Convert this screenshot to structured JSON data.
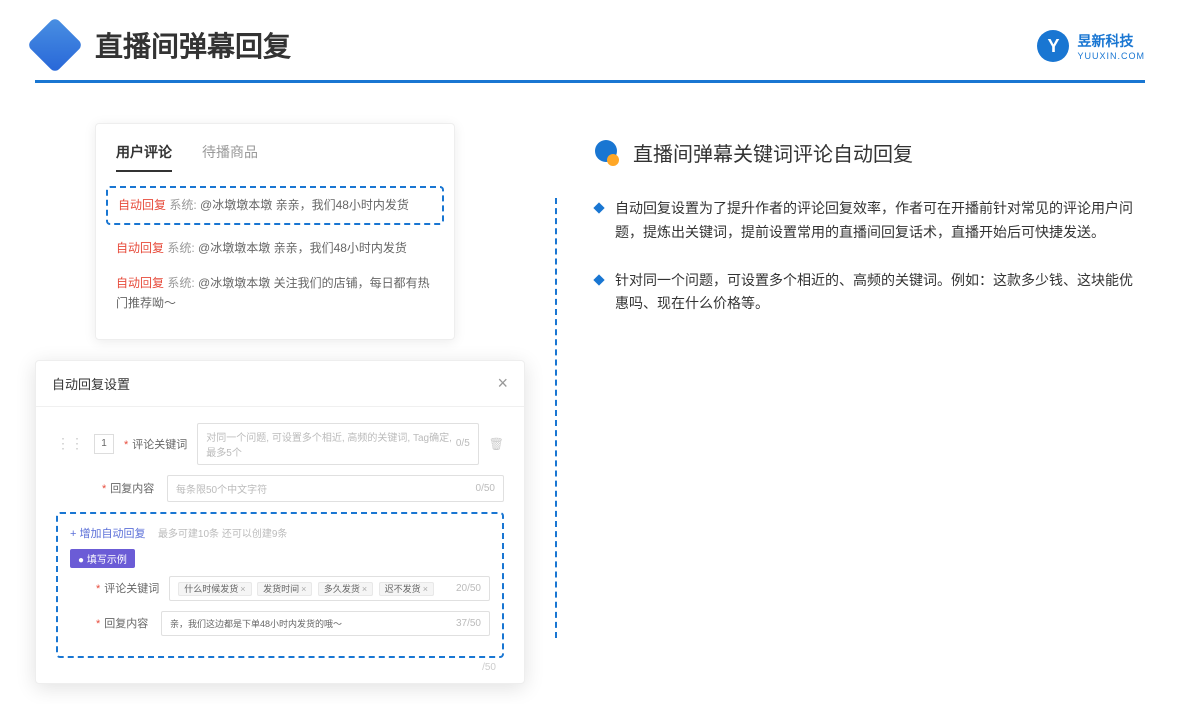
{
  "header": {
    "title": "直播间弹幕回复"
  },
  "brand": {
    "cn": "昱新科技",
    "en": "YUUXIN.COM"
  },
  "comments": {
    "tab1": "用户评论",
    "tab2": "待播商品",
    "autoLabel": "自动回复",
    "sysLabel": "系统:",
    "item1": "@冰墩墩本墩 亲亲，我们48小时内发货",
    "item2": "@冰墩墩本墩 亲亲，我们48小时内发货",
    "item3": "@冰墩墩本墩 关注我们的店铺，每日都有热门推荐呦～"
  },
  "modal": {
    "title": "自动回复设置",
    "rowNum": "1",
    "keywordLabel": "评论关键词",
    "keywordPlaceholder": "对同一个问题, 可设置多个相近, 高频的关键词, Tag确定, 最多5个",
    "keywordCounter": "0/5",
    "replyLabel": "回复内容",
    "replyPlaceholder": "每条限50个中文字符",
    "replyCounter": "0/50",
    "addLink": "+ 增加自动回复",
    "addHint": "最多可建10条 还可以创建9条",
    "exampleBadge": "● 填写示例",
    "exKw1": "什么时候发货",
    "exKw2": "发货时间",
    "exKw3": "多久发货",
    "exKw4": "迟不发货",
    "exKwCounter": "20/50",
    "exReply": "亲，我们这边都是下单48小时内发货的哦～",
    "exReplyCounter": "37/50",
    "bottomCounter": "/50"
  },
  "rightSection": {
    "title": "直播间弹幕关键词评论自动回复",
    "bullet1": "自动回复设置为了提升作者的评论回复效率，作者可在开播前针对常见的评论用户问题，提炼出关键词，提前设置常用的直播间回复话术，直播开始后可快捷发送。",
    "bullet2": "针对同一个问题，可设置多个相近的、高频的关键词。例如：这款多少钱、这块能优惠吗、现在什么价格等。"
  }
}
